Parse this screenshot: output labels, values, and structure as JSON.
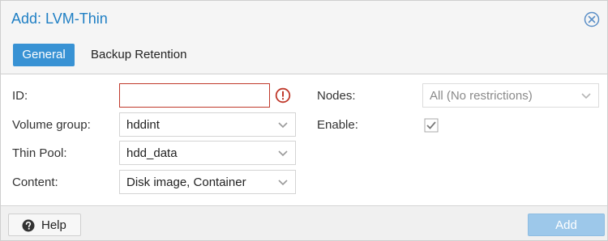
{
  "window": {
    "title": "Add: LVM-Thin"
  },
  "tabs": [
    {
      "label": "General",
      "active": true
    },
    {
      "label": "Backup Retention",
      "active": false
    }
  ],
  "form": {
    "id": {
      "label": "ID:",
      "value": "",
      "state": "error"
    },
    "volume_group": {
      "label": "Volume group:",
      "value": "hddint"
    },
    "thin_pool": {
      "label": "Thin Pool:",
      "value": "hdd_data"
    },
    "content": {
      "label": "Content:",
      "value": "Disk image, Container"
    },
    "nodes": {
      "label": "Nodes:",
      "value": "All (No restrictions)",
      "disabled": true
    },
    "enable": {
      "label": "Enable:",
      "checked": true
    }
  },
  "footer": {
    "help_label": "Help",
    "add_label": "Add"
  },
  "colors": {
    "accent": "#3892d4",
    "title": "#1f7fc4",
    "error": "#c0392b",
    "add_button": "#9dc8ea"
  },
  "icons": {
    "close": "close-circle-icon",
    "error": "exclamation-circle-icon",
    "help": "question-circle-icon",
    "dropdown": "chevron-down-icon",
    "check": "checkmark-icon"
  }
}
